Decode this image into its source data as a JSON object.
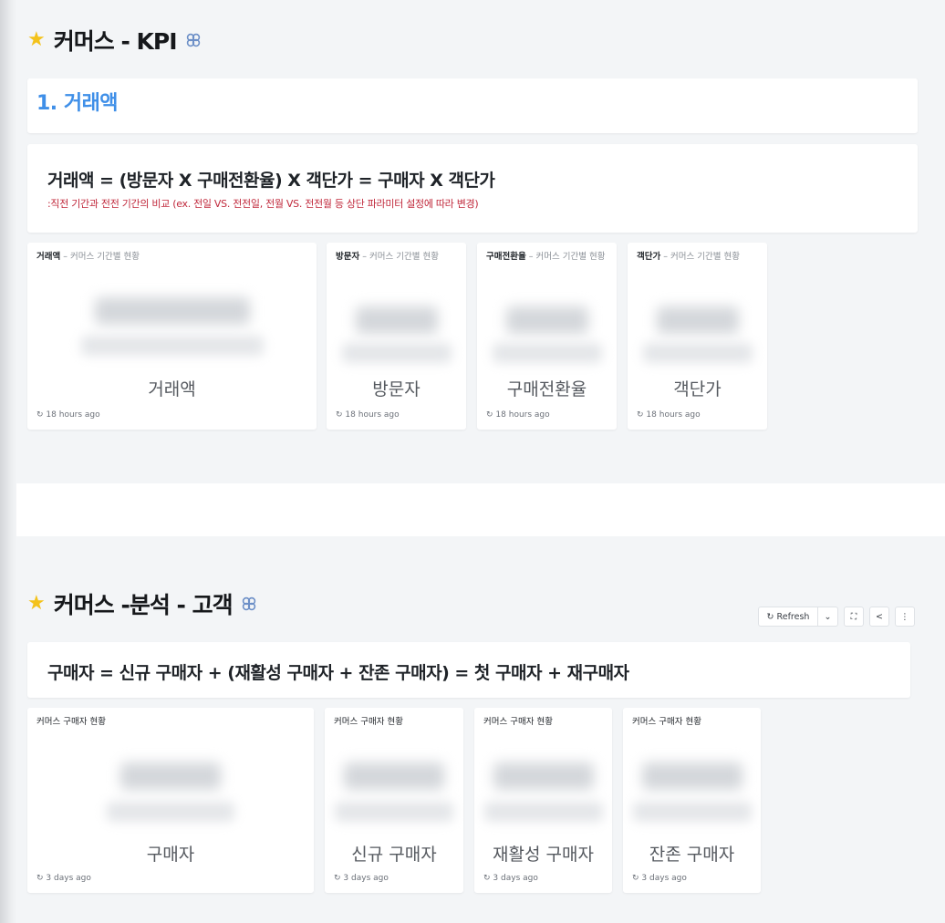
{
  "kpi": {
    "title": "커머스 - KPI",
    "heading": "1. 거래액",
    "formula": "거래액 = (방문자 X 구매전환율) X 객단가 = 구매자 X 객단가",
    "note": ":직전 기간과 전전 기간의 비교 (ex. 전일 VS. 전전일, 전월 VS. 전전월 등 상단 파라미터 설정에 따라 변경)",
    "cards": [
      {
        "name": "거래액",
        "subtitle": " – 커머스 기간별 현황",
        "label": "거래액",
        "updated": "18 hours ago"
      },
      {
        "name": "방문자",
        "subtitle": " – 커머스 기간별 현황",
        "label": "방문자",
        "updated": "18 hours ago"
      },
      {
        "name": "구매전환율",
        "subtitle": " – 커머스 기간별 현황",
        "label": "구매전환율",
        "updated": "18 hours ago"
      },
      {
        "name": "객단가",
        "subtitle": " – 커머스 기간별 현황",
        "label": "객단가",
        "updated": "18 hours ago"
      }
    ]
  },
  "customer": {
    "title": "커머스 -분석 - 고객",
    "formula": "구매자 = 신규 구매자 + (재활성 구매자 + 잔존 구매자) = 첫 구매자 + 재구매자",
    "cards": [
      {
        "name": "커머스 구매자 현황",
        "label": "구매자",
        "updated": "3 days ago"
      },
      {
        "name": "커머스 구매자 현황",
        "label": "신규 구매자",
        "updated": "3 days ago"
      },
      {
        "name": "커머스 구매자 현황",
        "label": "재활성 구매자",
        "updated": "3 days ago"
      },
      {
        "name": "커머스 구매자 현황",
        "label": "잔존 구매자",
        "updated": "3 days ago"
      }
    ]
  },
  "toolbar": {
    "refresh_label": "Refresh",
    "refresh_icon": "↻",
    "dropdown_icon": "⌄",
    "fullscreen_icon": "⛶",
    "share_icon": "<",
    "more_icon": "⋮"
  },
  "icons": {
    "star": "★",
    "refresh_small": "↻"
  },
  "colors": {
    "accent_blue": "#3f8fe8",
    "note_red": "#c0283b",
    "star": "#f3c21b"
  }
}
